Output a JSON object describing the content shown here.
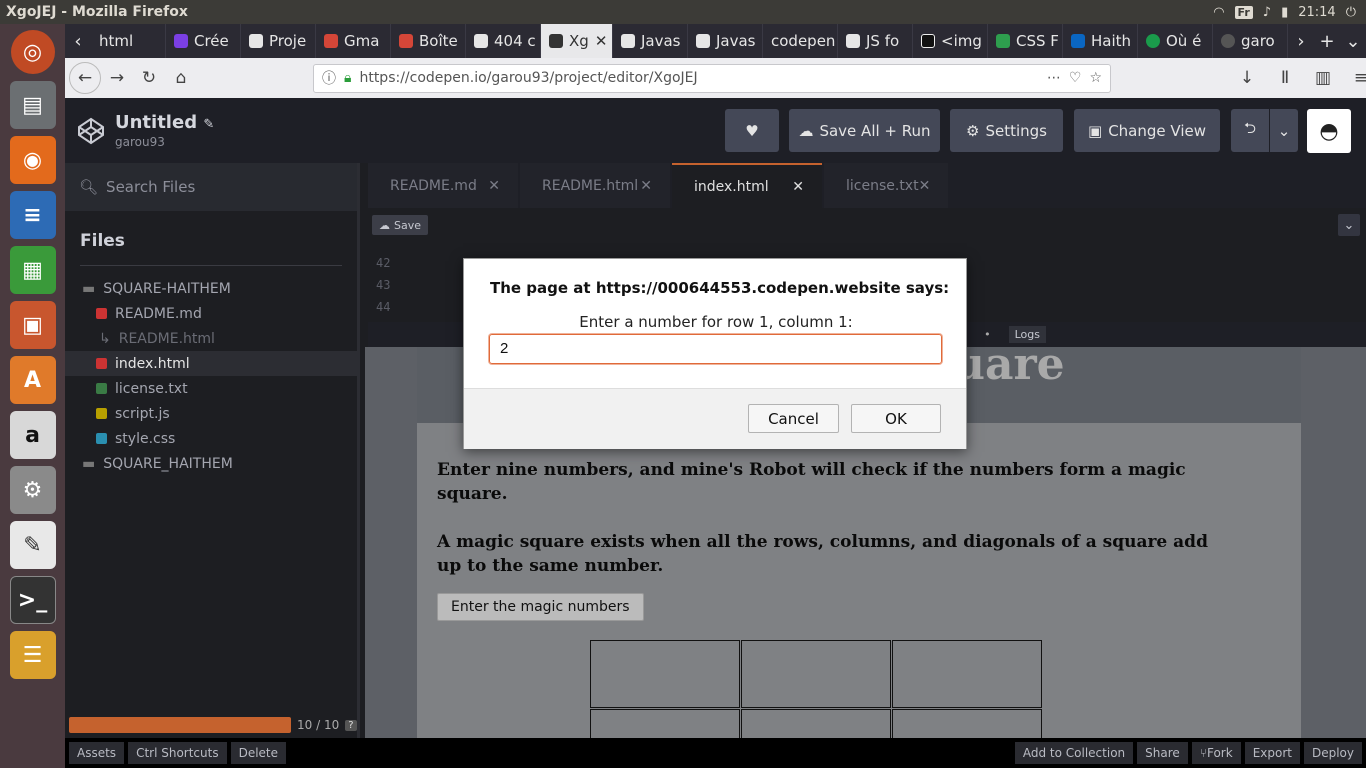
{
  "os": {
    "window_title": "XgoJEJ - Mozilla Firefox",
    "lang": "Fr",
    "time": "21:14"
  },
  "browser": {
    "tabs": [
      "html",
      "Crée",
      "Proje",
      "Gma",
      "Boîte",
      "404 c",
      "Xg",
      "Javas",
      "Javas",
      "codepen",
      "JS fo",
      "<img",
      "CSS F",
      "Haith",
      "Où é",
      "garo"
    ],
    "active_tab": 6,
    "url": "https://codepen.io/garou93/project/editor/XgoJEJ",
    "url_host": "codepen.io"
  },
  "codepen": {
    "project_title": "Untitled",
    "username": "garou93",
    "buttons": {
      "save_run": "Save All + Run",
      "settings": "Settings",
      "change_view": "Change View"
    },
    "search_placeholder": "Search Files",
    "files_heading": "Files",
    "tree": [
      {
        "name": "SQUARE-HAITHEM",
        "type": "folder"
      },
      {
        "name": "README.md",
        "type": "file",
        "color": "#c33"
      },
      {
        "name": "README.html",
        "type": "generated",
        "color": "#777"
      },
      {
        "name": "index.html",
        "type": "file",
        "color": "#c33",
        "active": true
      },
      {
        "name": "license.txt",
        "type": "file",
        "color": "#3a7b45"
      },
      {
        "name": "script.js",
        "type": "file",
        "color": "#b8a000"
      },
      {
        "name": "style.css",
        "type": "file",
        "color": "#2a8fb0"
      },
      {
        "name": "SQUARE_HAITHEM",
        "type": "folder"
      }
    ],
    "progress_text": "10 / 10",
    "editor_tabs": [
      "README.md",
      "README.html",
      "index.html",
      "license.txt"
    ],
    "active_editor_tab": 2,
    "save_label": "Save",
    "line_numbers": [
      "42",
      "43",
      "44"
    ],
    "logs_label": "Logs",
    "status_left": [
      "Assets",
      "Ctrl Shortcuts",
      "Delete"
    ],
    "status_right": [
      "Add to Collection",
      "Share",
      "Fork",
      "Export",
      "Deploy"
    ]
  },
  "preview": {
    "title_fragment": "uare",
    "para1": "Enter nine numbers, and mine's Robot will check if the numbers form a magic square.",
    "para2": "A magic square exists when all the rows, columns, and diagonals of a square add up to the same number.",
    "button": "Enter the magic numbers"
  },
  "dialog": {
    "title": "The page at https://000644553.codepen.website says:",
    "prompt": "Enter a number for row 1, column 1:",
    "value": "2",
    "cancel": "Cancel",
    "ok": "OK"
  }
}
